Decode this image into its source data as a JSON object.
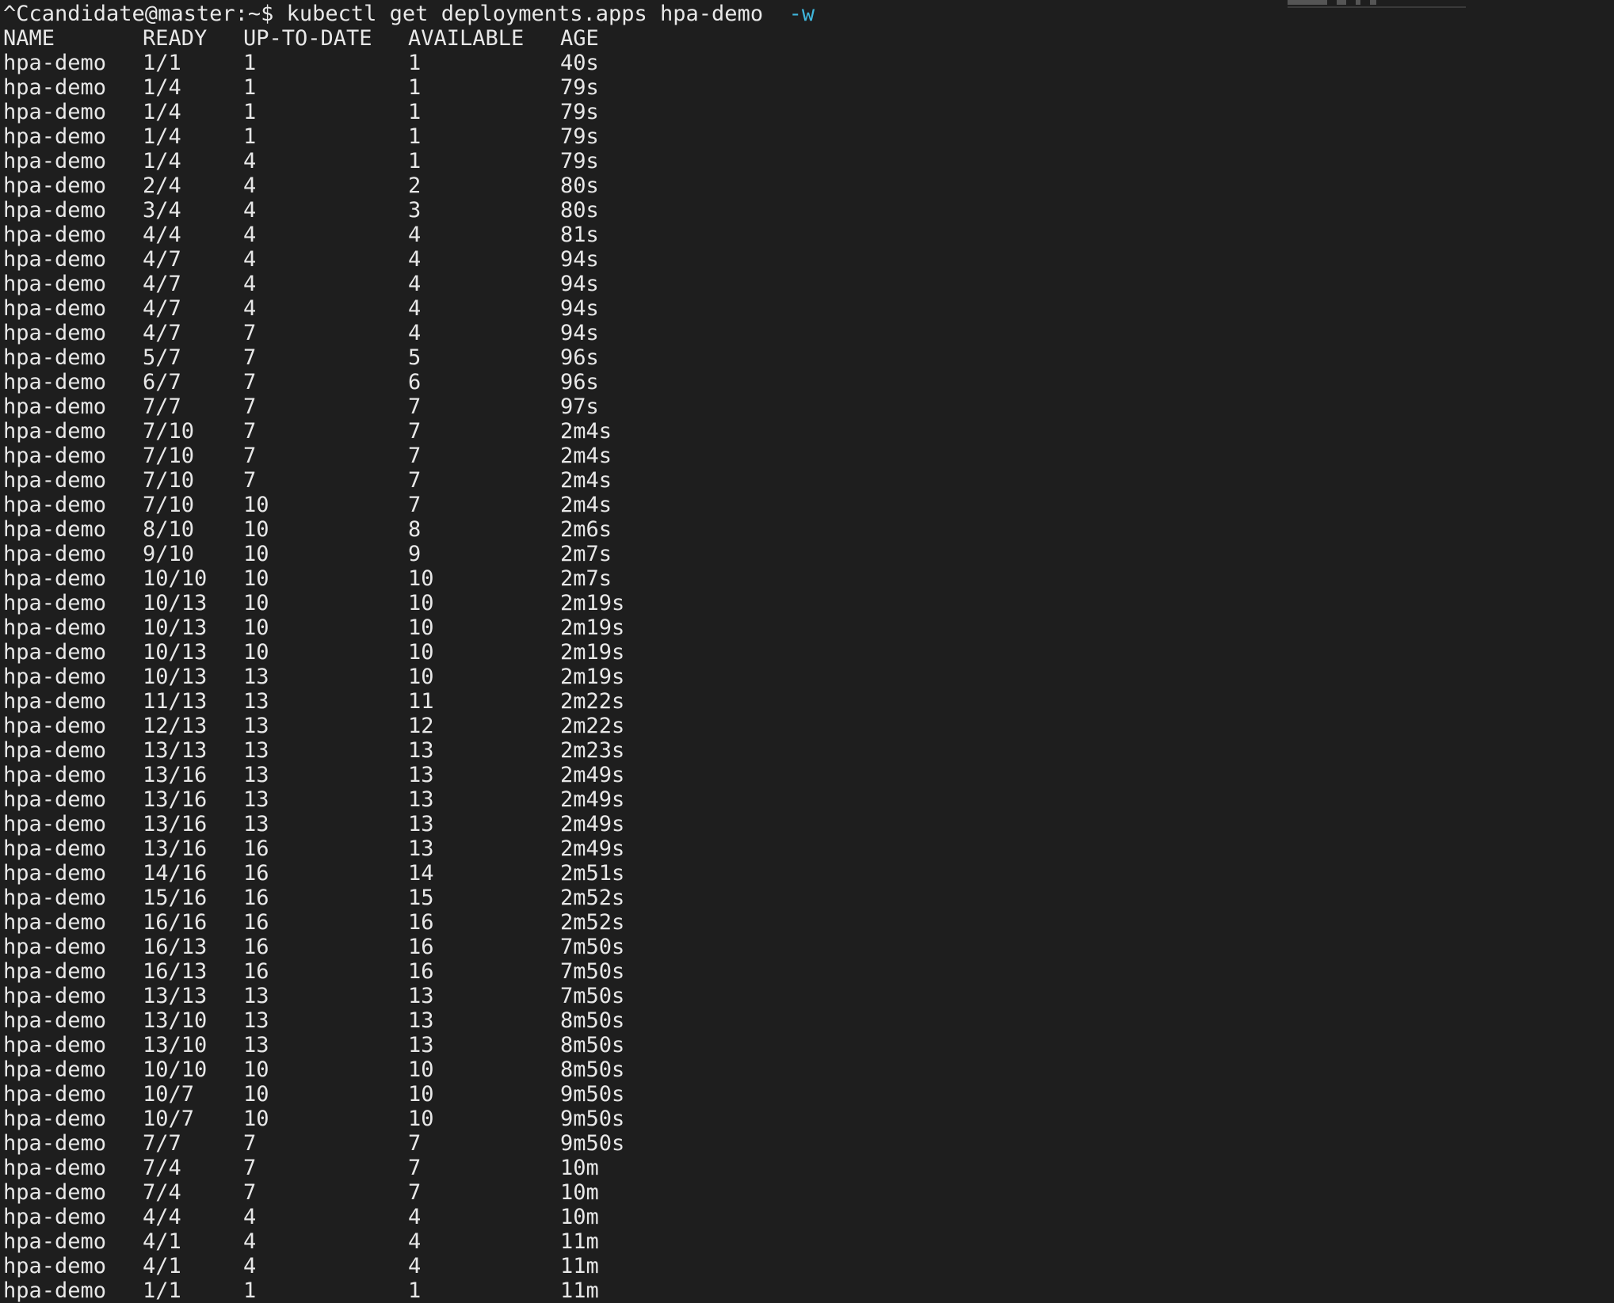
{
  "terminal": {
    "prompt": "^Ccandidate@master:~$ ",
    "command": "kubectl get deployments.apps hpa-demo  ",
    "flag": "-w",
    "colors": {
      "background": "#1e1e1e",
      "text": "#e8e8e8",
      "flag": "#3fb6dc"
    },
    "headers": {
      "name": "NAME",
      "ready": "READY",
      "uptodate": "UP-TO-DATE",
      "available": "AVAILABLE",
      "age": "AGE"
    },
    "rows": [
      {
        "name": "hpa-demo",
        "ready": "1/1",
        "uptodate": "1",
        "available": "1",
        "age": "40s"
      },
      {
        "name": "hpa-demo",
        "ready": "1/4",
        "uptodate": "1",
        "available": "1",
        "age": "79s"
      },
      {
        "name": "hpa-demo",
        "ready": "1/4",
        "uptodate": "1",
        "available": "1",
        "age": "79s"
      },
      {
        "name": "hpa-demo",
        "ready": "1/4",
        "uptodate": "1",
        "available": "1",
        "age": "79s"
      },
      {
        "name": "hpa-demo",
        "ready": "1/4",
        "uptodate": "4",
        "available": "1",
        "age": "79s"
      },
      {
        "name": "hpa-demo",
        "ready": "2/4",
        "uptodate": "4",
        "available": "2",
        "age": "80s"
      },
      {
        "name": "hpa-demo",
        "ready": "3/4",
        "uptodate": "4",
        "available": "3",
        "age": "80s"
      },
      {
        "name": "hpa-demo",
        "ready": "4/4",
        "uptodate": "4",
        "available": "4",
        "age": "81s"
      },
      {
        "name": "hpa-demo",
        "ready": "4/7",
        "uptodate": "4",
        "available": "4",
        "age": "94s"
      },
      {
        "name": "hpa-demo",
        "ready": "4/7",
        "uptodate": "4",
        "available": "4",
        "age": "94s"
      },
      {
        "name": "hpa-demo",
        "ready": "4/7",
        "uptodate": "4",
        "available": "4",
        "age": "94s"
      },
      {
        "name": "hpa-demo",
        "ready": "4/7",
        "uptodate": "7",
        "available": "4",
        "age": "94s"
      },
      {
        "name": "hpa-demo",
        "ready": "5/7",
        "uptodate": "7",
        "available": "5",
        "age": "96s"
      },
      {
        "name": "hpa-demo",
        "ready": "6/7",
        "uptodate": "7",
        "available": "6",
        "age": "96s"
      },
      {
        "name": "hpa-demo",
        "ready": "7/7",
        "uptodate": "7",
        "available": "7",
        "age": "97s"
      },
      {
        "name": "hpa-demo",
        "ready": "7/10",
        "uptodate": "7",
        "available": "7",
        "age": "2m4s"
      },
      {
        "name": "hpa-demo",
        "ready": "7/10",
        "uptodate": "7",
        "available": "7",
        "age": "2m4s"
      },
      {
        "name": "hpa-demo",
        "ready": "7/10",
        "uptodate": "7",
        "available": "7",
        "age": "2m4s"
      },
      {
        "name": "hpa-demo",
        "ready": "7/10",
        "uptodate": "10",
        "available": "7",
        "age": "2m4s"
      },
      {
        "name": "hpa-demo",
        "ready": "8/10",
        "uptodate": "10",
        "available": "8",
        "age": "2m6s"
      },
      {
        "name": "hpa-demo",
        "ready": "9/10",
        "uptodate": "10",
        "available": "9",
        "age": "2m7s"
      },
      {
        "name": "hpa-demo",
        "ready": "10/10",
        "uptodate": "10",
        "available": "10",
        "age": "2m7s"
      },
      {
        "name": "hpa-demo",
        "ready": "10/13",
        "uptodate": "10",
        "available": "10",
        "age": "2m19s"
      },
      {
        "name": "hpa-demo",
        "ready": "10/13",
        "uptodate": "10",
        "available": "10",
        "age": "2m19s"
      },
      {
        "name": "hpa-demo",
        "ready": "10/13",
        "uptodate": "10",
        "available": "10",
        "age": "2m19s"
      },
      {
        "name": "hpa-demo",
        "ready": "10/13",
        "uptodate": "13",
        "available": "10",
        "age": "2m19s"
      },
      {
        "name": "hpa-demo",
        "ready": "11/13",
        "uptodate": "13",
        "available": "11",
        "age": "2m22s"
      },
      {
        "name": "hpa-demo",
        "ready": "12/13",
        "uptodate": "13",
        "available": "12",
        "age": "2m22s"
      },
      {
        "name": "hpa-demo",
        "ready": "13/13",
        "uptodate": "13",
        "available": "13",
        "age": "2m23s"
      },
      {
        "name": "hpa-demo",
        "ready": "13/16",
        "uptodate": "13",
        "available": "13",
        "age": "2m49s"
      },
      {
        "name": "hpa-demo",
        "ready": "13/16",
        "uptodate": "13",
        "available": "13",
        "age": "2m49s"
      },
      {
        "name": "hpa-demo",
        "ready": "13/16",
        "uptodate": "13",
        "available": "13",
        "age": "2m49s"
      },
      {
        "name": "hpa-demo",
        "ready": "13/16",
        "uptodate": "16",
        "available": "13",
        "age": "2m49s"
      },
      {
        "name": "hpa-demo",
        "ready": "14/16",
        "uptodate": "16",
        "available": "14",
        "age": "2m51s"
      },
      {
        "name": "hpa-demo",
        "ready": "15/16",
        "uptodate": "16",
        "available": "15",
        "age": "2m52s"
      },
      {
        "name": "hpa-demo",
        "ready": "16/16",
        "uptodate": "16",
        "available": "16",
        "age": "2m52s"
      },
      {
        "name": "hpa-demo",
        "ready": "16/13",
        "uptodate": "16",
        "available": "16",
        "age": "7m50s"
      },
      {
        "name": "hpa-demo",
        "ready": "16/13",
        "uptodate": "16",
        "available": "16",
        "age": "7m50s"
      },
      {
        "name": "hpa-demo",
        "ready": "13/13",
        "uptodate": "13",
        "available": "13",
        "age": "7m50s"
      },
      {
        "name": "hpa-demo",
        "ready": "13/10",
        "uptodate": "13",
        "available": "13",
        "age": "8m50s"
      },
      {
        "name": "hpa-demo",
        "ready": "13/10",
        "uptodate": "13",
        "available": "13",
        "age": "8m50s"
      },
      {
        "name": "hpa-demo",
        "ready": "10/10",
        "uptodate": "10",
        "available": "10",
        "age": "8m50s"
      },
      {
        "name": "hpa-demo",
        "ready": "10/7",
        "uptodate": "10",
        "available": "10",
        "age": "9m50s"
      },
      {
        "name": "hpa-demo",
        "ready": "10/7",
        "uptodate": "10",
        "available": "10",
        "age": "9m50s"
      },
      {
        "name": "hpa-demo",
        "ready": "7/7",
        "uptodate": "7",
        "available": "7",
        "age": "9m50s"
      },
      {
        "name": "hpa-demo",
        "ready": "7/4",
        "uptodate": "7",
        "available": "7",
        "age": "10m"
      },
      {
        "name": "hpa-demo",
        "ready": "7/4",
        "uptodate": "7",
        "available": "7",
        "age": "10m"
      },
      {
        "name": "hpa-demo",
        "ready": "4/4",
        "uptodate": "4",
        "available": "4",
        "age": "10m"
      },
      {
        "name": "hpa-demo",
        "ready": "4/1",
        "uptodate": "4",
        "available": "4",
        "age": "11m"
      },
      {
        "name": "hpa-demo",
        "ready": "4/1",
        "uptodate": "4",
        "available": "4",
        "age": "11m"
      },
      {
        "name": "hpa-demo",
        "ready": "1/1",
        "uptodate": "1",
        "available": "1",
        "age": "11m"
      }
    ]
  }
}
